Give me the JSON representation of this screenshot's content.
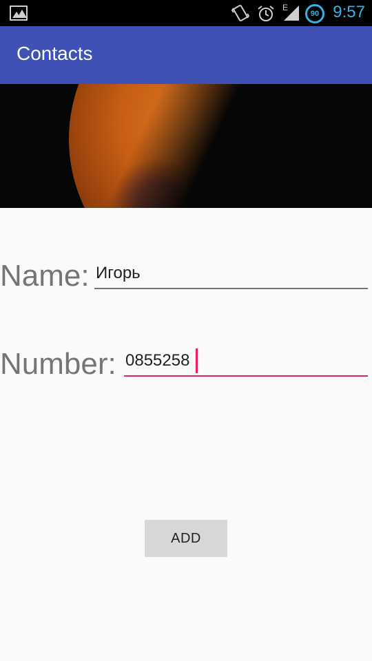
{
  "status_bar": {
    "time": "9:57",
    "battery_level": "90",
    "network_type": "E",
    "icons": [
      "gallery-icon",
      "vibrate-icon",
      "alarm-icon",
      "signal-icon",
      "battery-icon"
    ],
    "accent_color": "#33b5e5"
  },
  "app_bar": {
    "title": "Contacts",
    "color": "#3f51b5"
  },
  "header_image": {
    "subject": "planet-mars"
  },
  "form": {
    "name_label": "Name:",
    "name_value": "Игорь",
    "number_label": "Number:",
    "number_value": "0855258",
    "focus_color": "#e91e63"
  },
  "add_button": {
    "label": "ADD"
  }
}
